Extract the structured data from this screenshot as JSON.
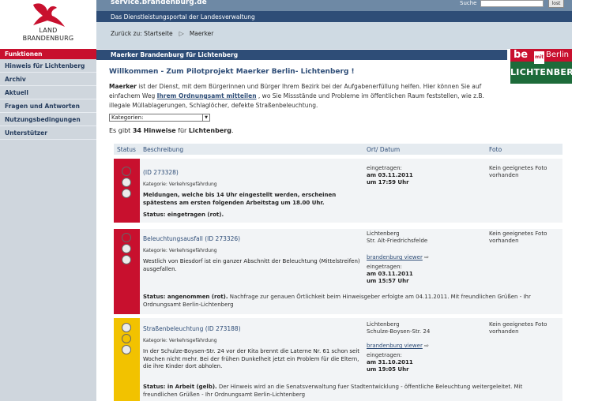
{
  "logo": {
    "line1": "LAND",
    "line2": "BRANDENBURG"
  },
  "header": {
    "site_url": "service.brandenburg.de",
    "search_label": "Suche",
    "search_value": "",
    "search_button": "lost",
    "portal": "Das Dienstleistungsportal der Landesverwaltung"
  },
  "breadcrumb": {
    "back": "Zurück zu: Startseite",
    "current": "Maerker"
  },
  "sidebar": {
    "head": "Funktionen",
    "items": [
      "Hinweis für Lichtenberg",
      "Archiv",
      "Aktuell",
      "Fragen und Antworten",
      "Nutzungsbedingungen",
      "Unterstützer"
    ]
  },
  "main": {
    "title": "Maerker Brandenburg für Lichtenberg",
    "partner_logo": {
      "be": "be",
      "mit": "mit",
      "berlin": "Berlin",
      "bottom": "LICHTENBERG"
    },
    "welcome": "Willkommen - Zum Pilotprojekt Maerker Berlin- Lichtenberg !",
    "intro_bold": "Maerker",
    "intro_1": " ist der Dienst, mit dem Bürgerinnen und Bürger Ihrem Bezirk bei der Aufgabenerfüllung helfen. Hier können Sie auf einfachem Weg ",
    "intro_link": "Ihrem Ordnungsamt mitteilen",
    "intro_2": " , wo Sie Missstände und Probleme im öffentlichen Raum feststellen, wie z.B. illegale Müllablagerungen, Schlaglöcher, defekte Straßenbeleuchtung.",
    "category_select": "Kategorien:",
    "count_pre": "Es gibt ",
    "count_num": "34 Hinweise",
    "count_mid": " für ",
    "count_place": "Lichtenberg",
    "count_end": "."
  },
  "table": {
    "headers": {
      "status": "Status",
      "desc": "Beschreibung",
      "ort": "Ort/ Datum",
      "foto": "Foto"
    },
    "rows": [
      {
        "status_color": "#c8102e",
        "active_light": 0,
        "title": "(ID 273328)",
        "category": "Kategorie: Verkehrsgefährdung",
        "text": "Meldungen, welche bis 14 Uhr eingestellt werden, erscheinen spätestens am ersten folgenden Arbeitstag um 18.00 Uhr.",
        "status_text": "Status: eingetragen (rot).",
        "ort_lines": [],
        "viewer": "",
        "date_label": "eingetragen:",
        "date": "am 03.11.2011",
        "time": "um 17:59 Uhr",
        "foto": "Kein geeignetes Foto vorhanden",
        "note": ""
      },
      {
        "status_color": "#c8102e",
        "active_light": 0,
        "title": "Beleuchtungsausfall (ID 273326)",
        "category": "Kategorie: Verkehrsgefährdung",
        "text": "Westlich von Biesdorf ist ein ganzer Abschnitt der Beleuchtung (Mittelstreifen) ausgefallen.",
        "status_text": "Status: angenommen (rot).",
        "ort_lines": [
          "Lichtenberg",
          "Str. Alt-Friedrichsfelde"
        ],
        "viewer": "brandenburg viewer",
        "date_label": "eingetragen:",
        "date": "am 03.11.2011",
        "time": "um 15:57 Uhr",
        "foto": "Kein geeignetes Foto vorhanden",
        "note": " Nachfrage zur genauen Örtlichkeit beim Hinweisgeber erfolgte am 04.11.2011. Mit freundlichen Grüßen - Ihr Ordnungsamt Berlin-Lichtenberg"
      },
      {
        "status_color": "#f2c200",
        "active_light": 1,
        "title": "Straßenbeleuchtung (ID 273188)",
        "category": "Kategorie: Verkehrsgefährdung",
        "text": "In der Schulze-Boysen-Str. 24 vor der Kita brennt die Laterne Nr. 61 schon seit Wochen nicht mehr. Bei der frühen Dunkelheit jetzt ein Problem für die Eltern, die ihre Kinder dort abholen.",
        "status_text": "Status: in Arbeit (gelb).",
        "ort_lines": [
          "Lichtenberg",
          "Schulze-Boysen-Str. 24"
        ],
        "viewer": "brandenburg viewer",
        "date_label": "eingetragen:",
        "date": "am 31.10.2011",
        "time": "um 19:05 Uhr",
        "foto": "Kein geeignetes Foto vorhanden",
        "note": " Der Hinweis wird an die Senatsverwaltung fuer Stadtentwicklung - öffentliche Beleuchtung weitergeleitet. Mit freundlichen Grüßen - Ihr Ordnungsamt Berlin-Lichtenberg"
      }
    ]
  }
}
